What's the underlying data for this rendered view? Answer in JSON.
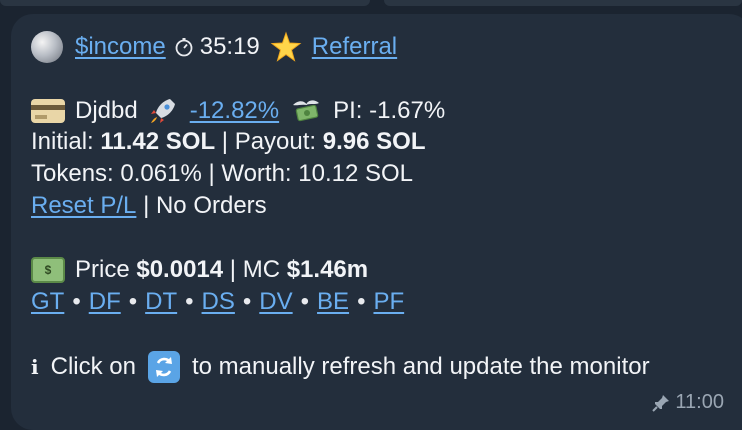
{
  "header": {
    "symbol_link": "$income",
    "timer_value": "35:19",
    "referral_link": "Referral"
  },
  "position": {
    "name": "Djdbd",
    "change_link": "-12.82%",
    "pl_label": "PI: -1.67%",
    "initial_label": "Initial:",
    "initial_value": "11.42 SOL",
    "payout_label": "| Payout:",
    "payout_value": "9.96 SOL",
    "tokens_text": "Tokens: 0.061% | Worth: 10.12 SOL",
    "reset_link": "Reset P/L",
    "orders_text": "| No Orders"
  },
  "market": {
    "bills_glyph": "$",
    "price_label": "Price",
    "price_value": "$0.0014",
    "mc_label": "| MC",
    "mc_value": "$1.46m",
    "links": [
      "GT",
      "DF",
      "DT",
      "DS",
      "DV",
      "BE",
      "PF"
    ],
    "separator": "•"
  },
  "footer": {
    "info_glyph": "i",
    "click_on": "Click on",
    "instruction": "to manually refresh and update the monitor",
    "time": "11:00"
  },
  "icons": {
    "globe": "globe-icon",
    "timer": "stopwatch-icon",
    "star": "star-icon",
    "card": "credit-card-icon",
    "rocket": "rocket-icon",
    "money": "money-wings-icon",
    "bills": "dollar-banknote-icon",
    "info": "info-icon",
    "refresh": "refresh-icon",
    "pin": "pin-icon"
  },
  "colors": {
    "bubble": "#232e3c",
    "background": "#1b2430",
    "link": "#6aaef0",
    "text": "#f2f4f7",
    "meta": "#9aa6b3"
  }
}
